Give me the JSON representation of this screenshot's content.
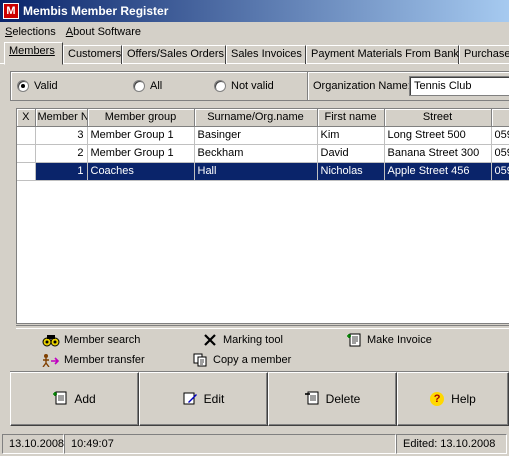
{
  "window": {
    "title": "Membis Member Register",
    "icon_letter": "M"
  },
  "menu": [
    {
      "label": "Selections",
      "underline": "S",
      "rest": "elections"
    },
    {
      "label": "About Software",
      "underline": "A",
      "rest": "bout Software"
    }
  ],
  "tabs": [
    "Members",
    "Customers",
    "Offers/Sales Orders",
    "Sales Invoices",
    "Payment Materials From Bank",
    "Purchase"
  ],
  "filter": {
    "options": [
      "Valid",
      "All",
      "Not valid"
    ],
    "selected": "Valid",
    "org_label": "Organization Name:",
    "org_value": "Tennis Club"
  },
  "table": {
    "columns": [
      "X",
      "Member No",
      "Member group",
      "Surname/Org.name",
      "First name",
      "Street",
      ""
    ],
    "rows": [
      {
        "no": "3",
        "group": "Member Group 1",
        "surname": "Basinger",
        "first": "Kim",
        "street": "Long Street 500",
        "extra": "059",
        "selected": false
      },
      {
        "no": "2",
        "group": "Member Group 1",
        "surname": "Beckham",
        "first": "David",
        "street": "Banana Street 300",
        "extra": "059",
        "selected": false
      },
      {
        "no": "1",
        "group": "Coaches",
        "surname": "Hall",
        "first": "Nicholas",
        "street": "Apple Street 456",
        "extra": "059",
        "selected": true
      }
    ]
  },
  "tools": {
    "member_search": "Member search",
    "marking_tool": "Marking tool",
    "make_invoice": "Make Invoice",
    "member_transfer": "Member transfer",
    "copy_member": "Copy a member"
  },
  "buttons": {
    "add": "Add",
    "edit": "Edit",
    "delete": "Delete",
    "help": "Help"
  },
  "status": {
    "date": "13.10.2008",
    "time": "10:49:07",
    "edited": "Edited: 13.10.2008"
  },
  "colors": {
    "title_start": "#0a246a",
    "title_end": "#a6caf0",
    "selection": "#0a246a",
    "face": "#d4d0c8"
  }
}
